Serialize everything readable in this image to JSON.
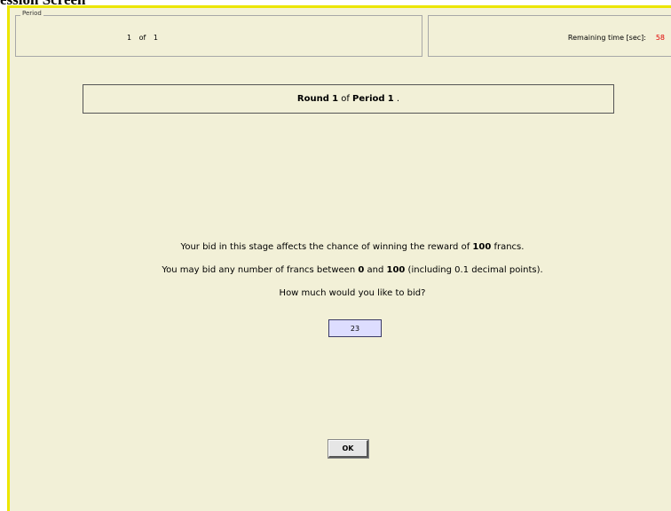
{
  "caption": "ession Screen",
  "period_panel": {
    "legend": "Period",
    "current": "1",
    "of_label": "of",
    "total": "1"
  },
  "timer": {
    "label": "Remaining time [sec]:",
    "value": "58",
    "value_color": "#e00000"
  },
  "round_header": {
    "round_word": "Round",
    "round_number": "1",
    "of_word": "of",
    "period_word": "Period",
    "period_number": "1",
    "trailing": "."
  },
  "instructions": {
    "line1_pre": "Your bid in this stage affects the chance of winning the reward of ",
    "line1_bold": "100",
    "line1_post": " francs.",
    "line2_pre": "You may bid any number of francs between ",
    "line2_bold1": "0",
    "line2_mid": " and ",
    "line2_bold2": "100",
    "line2_post": " (including 0.1 decimal points).",
    "line3": "How much would you like to bid?"
  },
  "bid_input": {
    "value": "23"
  },
  "ok_button": {
    "label": "OK"
  },
  "colors": {
    "background": "#f2f0d7",
    "border_accent": "#ece600",
    "input_bg": "#ddddff"
  }
}
